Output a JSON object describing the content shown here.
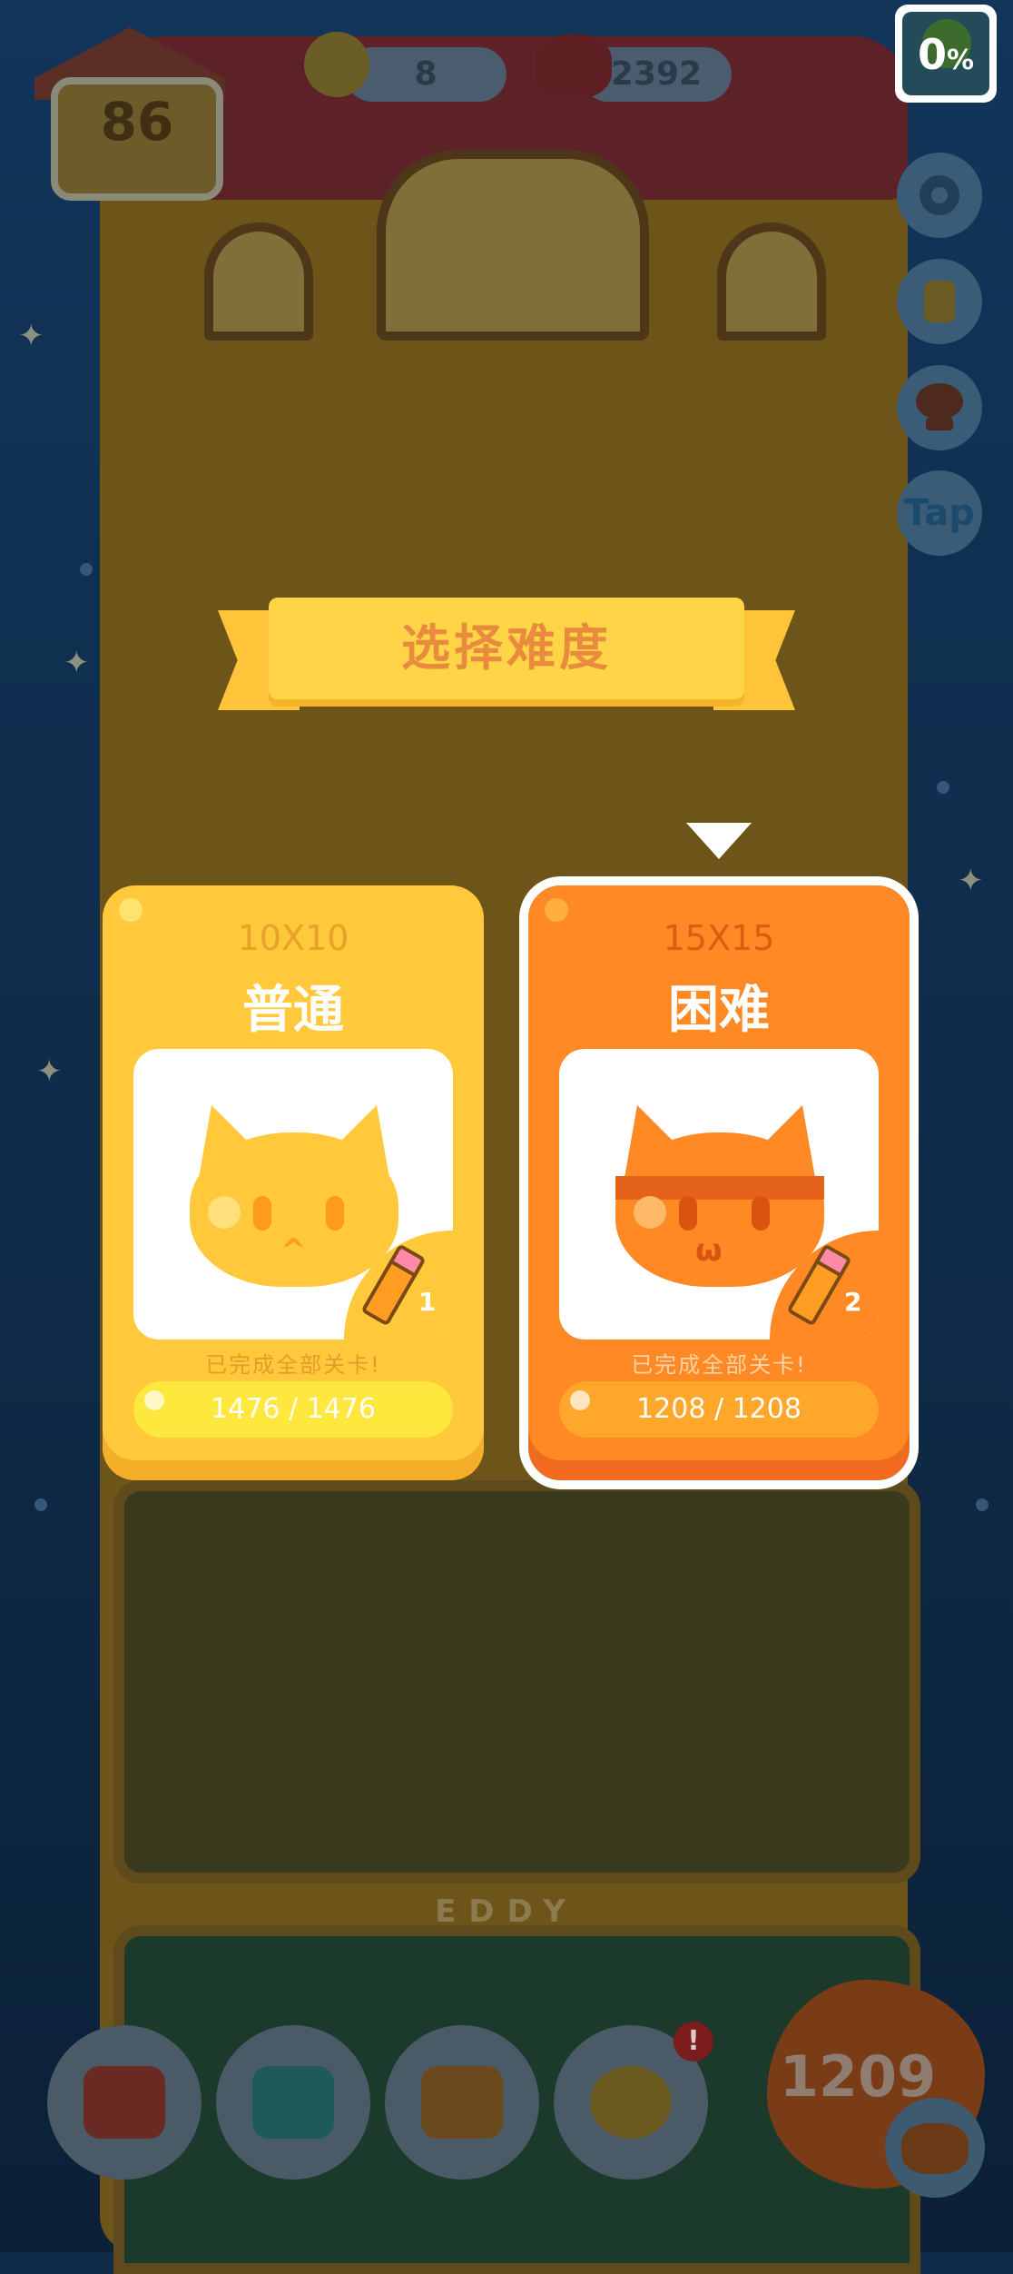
{
  "hud": {
    "level": "86",
    "pencils": "8",
    "coins": "2392",
    "progress_value": "0",
    "progress_unit": "%"
  },
  "side": {
    "tap_label": "Tap"
  },
  "scene": {
    "room_sign": "EDDY"
  },
  "modal": {
    "title": "选择难度",
    "cards": [
      {
        "size": "10X10",
        "name": "普通",
        "cost": "1",
        "status": "已完成全部关卡!",
        "progress": "1476 / 1476",
        "selected": false,
        "color": "#ffc93b"
      },
      {
        "size": "15X15",
        "name": "困难",
        "cost": "2",
        "status": "已完成全部关卡!",
        "progress": "1208 / 1208",
        "selected": true,
        "color": "#ff8a25"
      }
    ]
  },
  "bottom_nav": {
    "items": [
      {
        "icon": "armchair-icon"
      },
      {
        "icon": "paw-book-icon"
      },
      {
        "icon": "picture-frame-icon"
      },
      {
        "icon": "snow-globe-icon"
      }
    ],
    "notification_badge": "!",
    "puzzle_count": "1209"
  }
}
